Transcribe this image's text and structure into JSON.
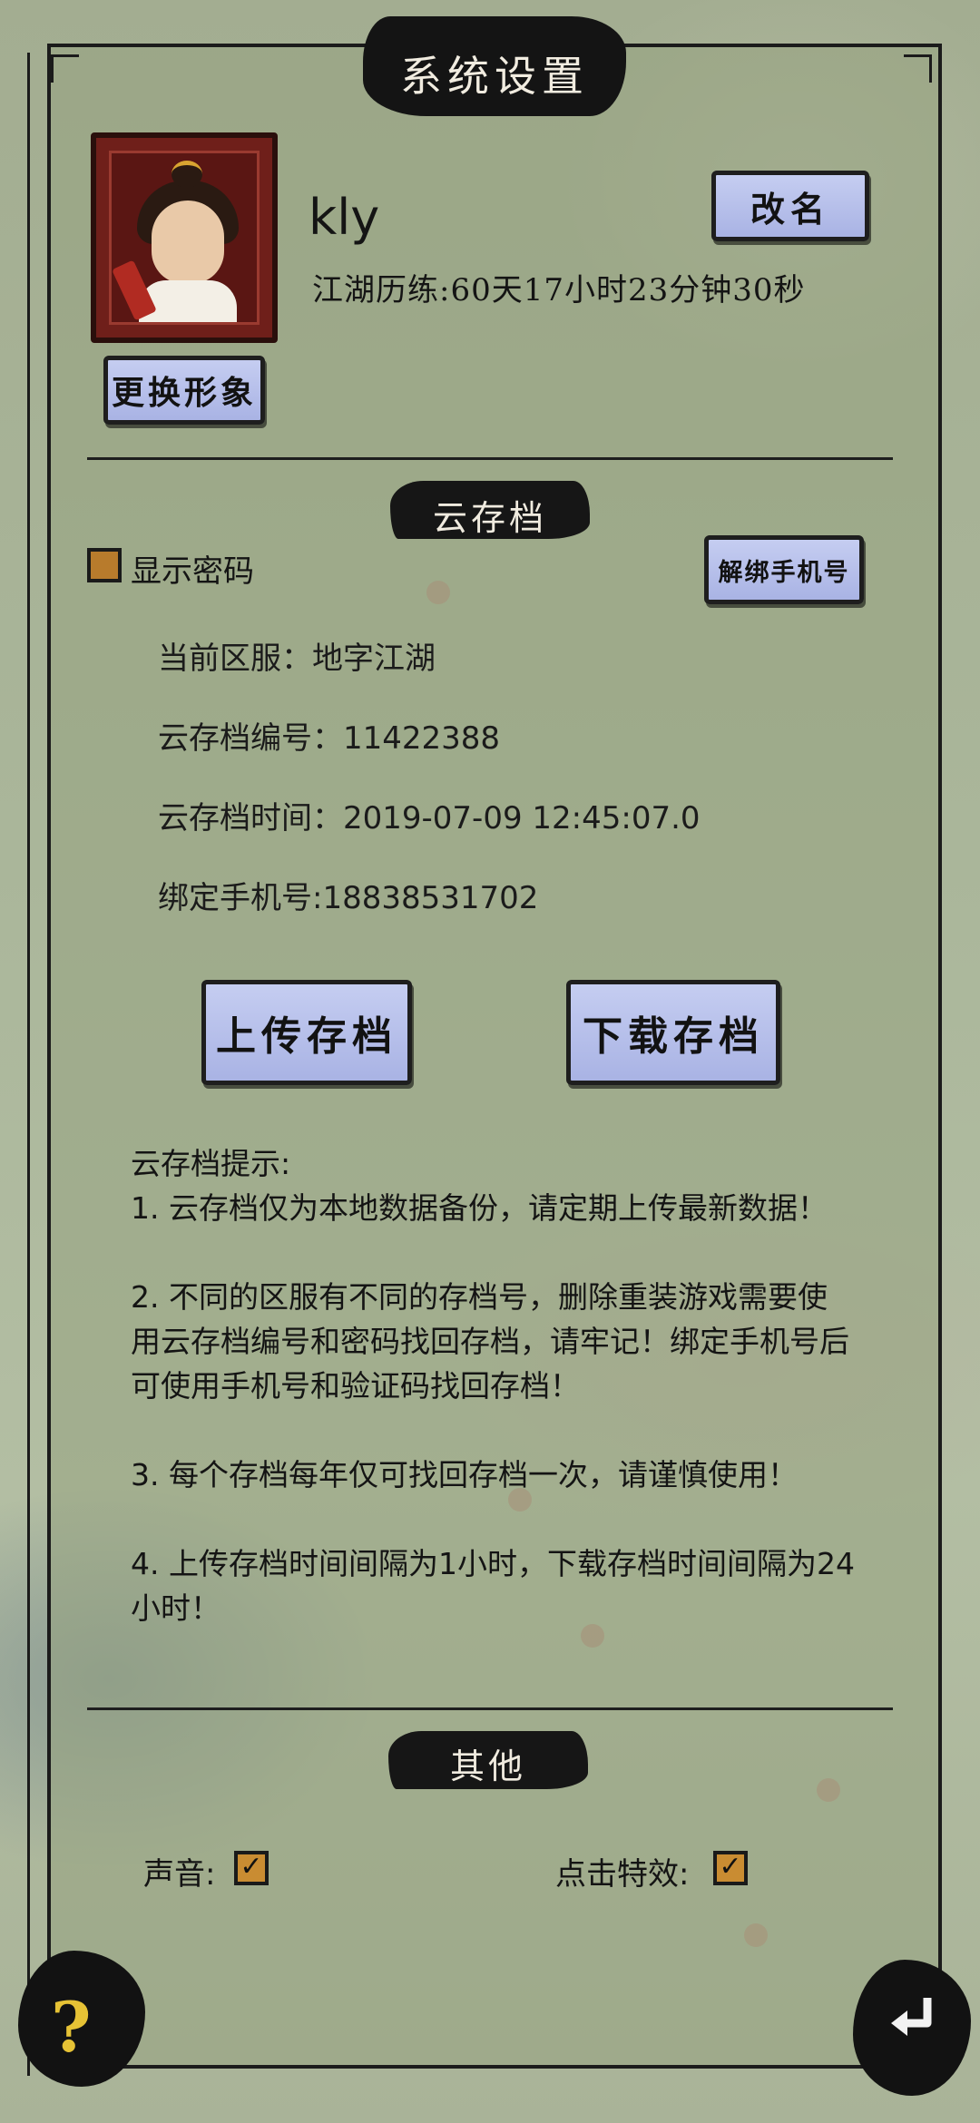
{
  "window": {
    "title": "系统设置"
  },
  "profile": {
    "name": "kly",
    "playtime": "江湖历练:60天17小时23分钟30秒",
    "rename_button": "改名",
    "change_avatar_button": "更换形象"
  },
  "cloud_save": {
    "section_title": "云存档",
    "show_password_label": "显示密码",
    "show_password_checked": false,
    "unbind_phone_button": "解绑手机号",
    "server": "当前区服：地字江湖",
    "save_id": "云存档编号：11422388",
    "save_time": "云存档时间：2019-07-09 12:45:07.0",
    "phone": "绑定手机号:18838531702",
    "upload_button": "上传存档",
    "download_button": "下载存档",
    "hints": "云存档提示:\n1. 云存档仅为本地数据备份，请定期上传最新数据！\n\n2. 不同的区服有不同的存档号，删除重装游戏需要使用云存档编号和密码找回存档，请牢记！绑定手机号后可使用手机号和验证码找回存档！\n\n3. 每个存档每年仅可找回存档一次，请谨慎使用！\n\n4. 上传存档时间间隔为1小时，下载存档时间间隔为24小时！"
  },
  "other": {
    "section_title": "其他",
    "sound_label": "声音:",
    "sound_checked": true,
    "click_effect_label": "点击特效:",
    "click_effect_checked": true
  },
  "footer": {
    "help_glyph": "?",
    "help_icon": "question-icon",
    "back_icon": "return-arrow-icon"
  },
  "colors": {
    "button_fill": "#b6bfeb",
    "ink": "#141414",
    "checkbox": "#c98c32",
    "help": "#e6c235"
  }
}
